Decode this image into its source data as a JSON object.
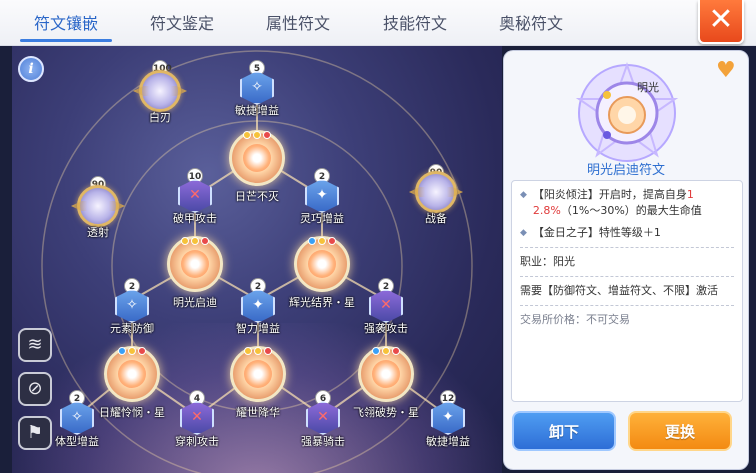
{
  "tabs": [
    {
      "label": "符文镶嵌",
      "active": true
    },
    {
      "label": "符文鉴定",
      "active": false
    },
    {
      "label": "属性符文",
      "active": false
    },
    {
      "label": "技能符文",
      "active": false
    },
    {
      "label": "奥秘符文",
      "active": false
    }
  ],
  "close_label": "✕",
  "info_label": "i",
  "board": {
    "nodes": [
      {
        "label": "白刃",
        "level": "100"
      },
      {
        "label": "敏捷增益",
        "level": "5"
      },
      {
        "label": "透射",
        "level": "90"
      },
      {
        "label": "战备",
        "level": "90"
      },
      {
        "label": "日芒不灭",
        "level": ""
      },
      {
        "label": "破甲攻击",
        "level": "10"
      },
      {
        "label": "灵巧增益",
        "level": "2"
      },
      {
        "label": "明光启迪",
        "level": ""
      },
      {
        "label": "辉光结界・星",
        "level": ""
      },
      {
        "label": "元素防御",
        "level": "2"
      },
      {
        "label": "智力增益",
        "level": "2"
      },
      {
        "label": "强袭攻击",
        "level": "2"
      },
      {
        "label": "日耀怜悯・星",
        "level": ""
      },
      {
        "label": "耀世降华",
        "level": ""
      },
      {
        "label": "飞翎破势・星",
        "level": ""
      },
      {
        "label": "体型增益",
        "level": "2"
      },
      {
        "label": "穿刺攻击",
        "level": "4"
      },
      {
        "label": "强暴骑击",
        "level": "6"
      },
      {
        "label": "敏捷增益",
        "level": "12"
      }
    ]
  },
  "panel": {
    "emblem_text": "明光",
    "rune_name": "明光启迪符文",
    "effects": [
      {
        "prefix": "【阳炎倾注】开启时，提高自身",
        "highlight": "1",
        "rest": ""
      },
      {
        "highlight2": "2.8%",
        "rest2": "（1%～30%）的最大生命值"
      }
    ],
    "effect1_line1a": "【阳炎倾注】开启时，提高自身",
    "effect1_red1": "1",
    "effect1_red2": "2.8%",
    "effect1_line2": "（1%～30%）的最大生命值",
    "effect2": "【金日之子】特性等级＋1",
    "job": "职业：阳光",
    "requirement": "需要【防御符文、增益符文、不限】激活",
    "trade": "交易所价格：",
    "trade_value": "不可交易",
    "unload_label": "卸下",
    "replace_label": "更换"
  },
  "colors": {
    "accent_blue": "#2e6fd0",
    "close_orange": "#e8491c",
    "button_orange": "#f38a12",
    "button_blue": "#2e6ed6"
  }
}
